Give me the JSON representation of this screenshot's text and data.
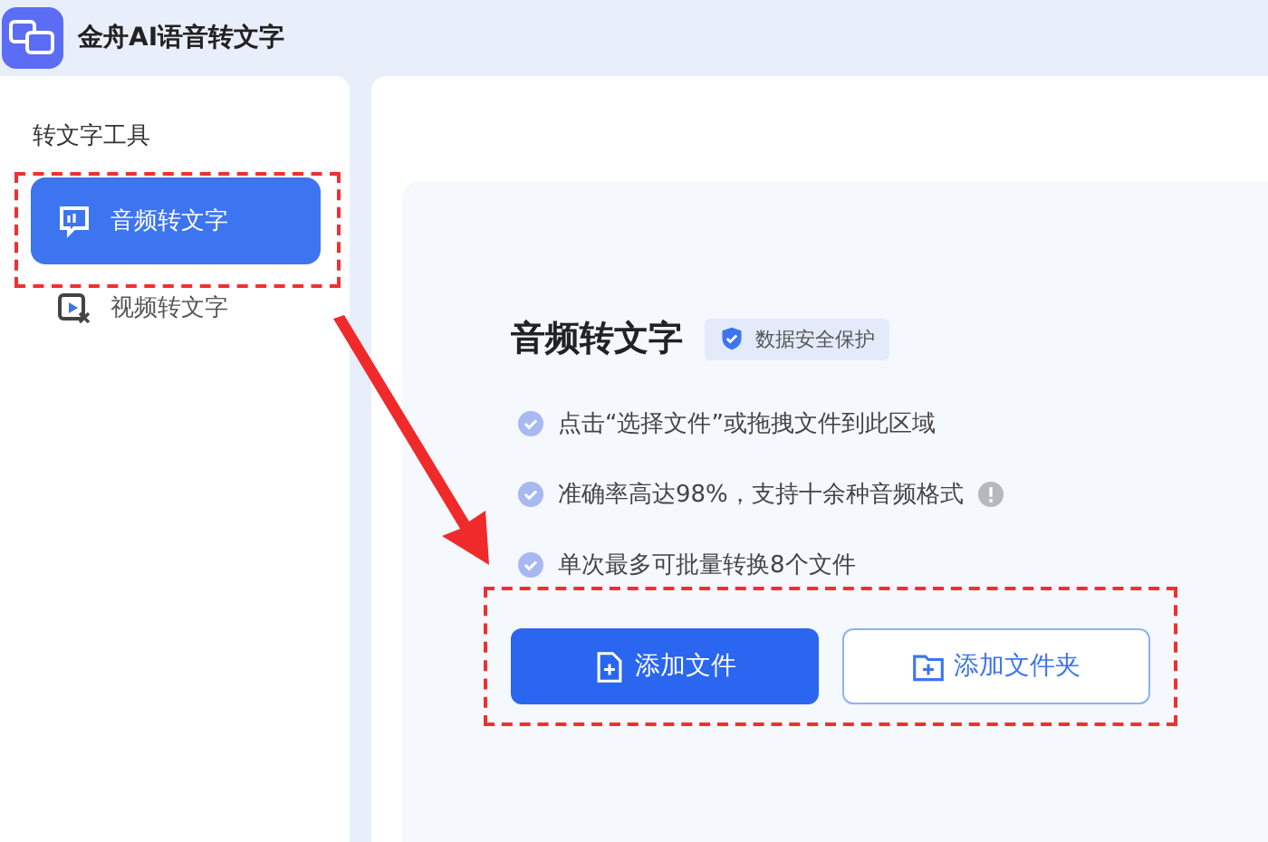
{
  "app": {
    "title": "金舟AI语音转文字"
  },
  "sidebar": {
    "heading": "转文字工具",
    "items": [
      {
        "label": "音频转文字",
        "kind": "audio",
        "selected": true
      },
      {
        "label": "视频转文字",
        "kind": "video",
        "selected": false
      }
    ]
  },
  "card": {
    "title": "音频转文字",
    "badge": "数据安全保护",
    "features": [
      {
        "text": "点击“选择文件”或拖拽文件到此区域",
        "info": false
      },
      {
        "text": "准确率高达98%，支持十余种音频格式",
        "info": true
      },
      {
        "text": "单次最多可批量转换8个文件",
        "info": false
      }
    ],
    "buttons": [
      {
        "label": "添加文件",
        "kind": "file"
      },
      {
        "label": "添加文件夹",
        "kind": "folder"
      }
    ]
  }
}
